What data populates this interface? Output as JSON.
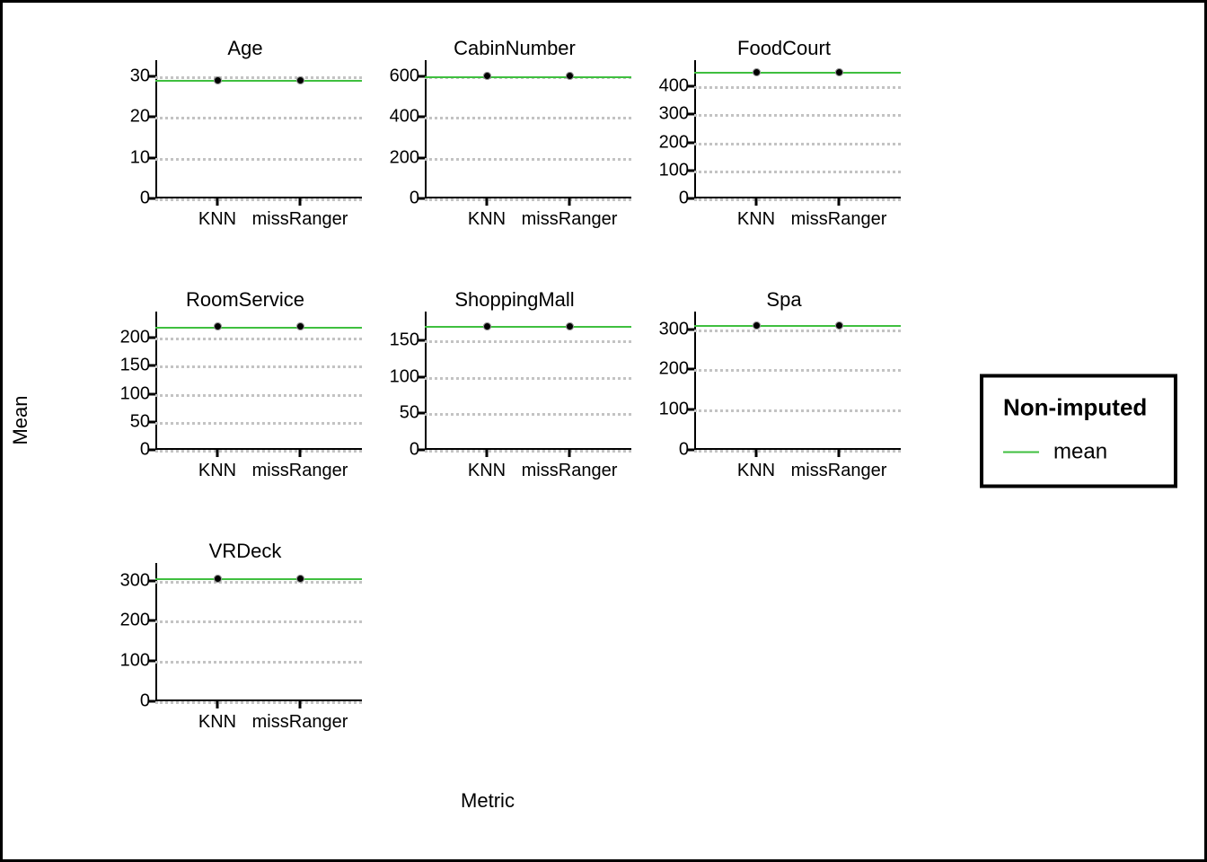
{
  "axis": {
    "ylabel": "Mean",
    "xlabel": "Metric"
  },
  "categories": [
    "KNN",
    "missRanger"
  ],
  "legend": {
    "title": "Non-imputed",
    "item_label": "mean"
  },
  "panels": [
    {
      "title": "Age",
      "y_ticks": [
        0,
        10,
        20,
        30
      ],
      "ymax": 33,
      "mean": 29,
      "points": [
        29,
        29
      ]
    },
    {
      "title": "CabinNumber",
      "y_ticks": [
        0,
        200,
        400,
        600
      ],
      "ymax": 660,
      "mean": 600,
      "points": [
        600,
        600
      ]
    },
    {
      "title": "FoodCourt",
      "y_ticks": [
        0,
        100,
        200,
        300,
        400
      ],
      "ymax": 480,
      "mean": 450,
      "points": [
        450,
        450
      ]
    },
    {
      "title": "RoomService",
      "y_ticks": [
        0,
        50,
        100,
        150,
        200
      ],
      "ymax": 240,
      "mean": 220,
      "points": [
        220,
        220
      ]
    },
    {
      "title": "ShoppingMall",
      "y_ticks": [
        0,
        50,
        100,
        150
      ],
      "ymax": 185,
      "mean": 170,
      "points": [
        170,
        170
      ]
    },
    {
      "title": "Spa",
      "y_ticks": [
        0,
        100,
        200,
        300
      ],
      "ymax": 335,
      "mean": 310,
      "points": [
        310,
        310
      ]
    },
    {
      "title": "VRDeck",
      "y_ticks": [
        0,
        100,
        200,
        300
      ],
      "ymax": 335,
      "mean": 305,
      "points": [
        305,
        305
      ]
    }
  ],
  "chart_data": {
    "type": "scatter",
    "facets": [
      {
        "name": "Age",
        "categories": [
          "KNN",
          "missRanger"
        ],
        "values": [
          29,
          29
        ],
        "mean_line": 29,
        "ylim": [
          0,
          33
        ],
        "y_ticks": [
          0,
          10,
          20,
          30
        ]
      },
      {
        "name": "CabinNumber",
        "categories": [
          "KNN",
          "missRanger"
        ],
        "values": [
          600,
          600
        ],
        "mean_line": 600,
        "ylim": [
          0,
          660
        ],
        "y_ticks": [
          0,
          200,
          400,
          600
        ]
      },
      {
        "name": "FoodCourt",
        "categories": [
          "KNN",
          "missRanger"
        ],
        "values": [
          450,
          450
        ],
        "mean_line": 450,
        "ylim": [
          0,
          480
        ],
        "y_ticks": [
          0,
          100,
          200,
          300,
          400
        ]
      },
      {
        "name": "RoomService",
        "categories": [
          "KNN",
          "missRanger"
        ],
        "values": [
          220,
          220
        ],
        "mean_line": 220,
        "ylim": [
          0,
          240
        ],
        "y_ticks": [
          0,
          50,
          100,
          150,
          200
        ]
      },
      {
        "name": "ShoppingMall",
        "categories": [
          "KNN",
          "missRanger"
        ],
        "values": [
          170,
          170
        ],
        "mean_line": 170,
        "ylim": [
          0,
          185
        ],
        "y_ticks": [
          0,
          50,
          100,
          150
        ]
      },
      {
        "name": "Spa",
        "categories": [
          "KNN",
          "missRanger"
        ],
        "values": [
          310,
          310
        ],
        "mean_line": 310,
        "ylim": [
          0,
          335
        ],
        "y_ticks": [
          0,
          100,
          200,
          300
        ]
      },
      {
        "name": "VRDeck",
        "categories": [
          "KNN",
          "missRanger"
        ],
        "values": [
          305,
          305
        ],
        "mean_line": 305,
        "ylim": [
          0,
          335
        ],
        "y_ticks": [
          0,
          100,
          200,
          300
        ]
      }
    ],
    "xlabel": "Metric",
    "ylabel": "Mean",
    "legend": {
      "title": "Non-imputed",
      "entries": [
        "mean"
      ]
    },
    "colors": {
      "mean_line": "#3fbf3f",
      "points": "#000000"
    }
  }
}
